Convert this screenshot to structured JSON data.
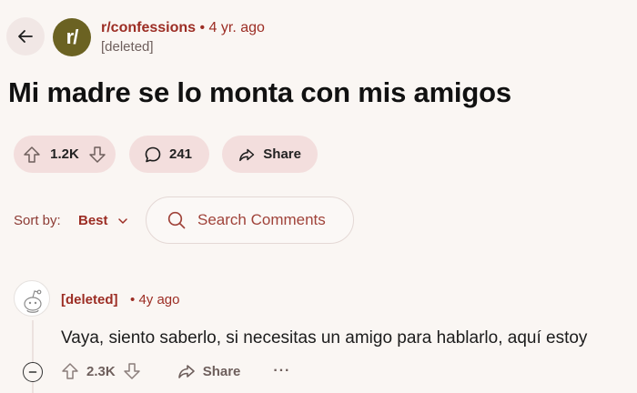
{
  "header": {
    "back_icon": "arrow-left-icon",
    "subreddit_avatar_text": "r/",
    "subreddit_avatar_color": "#6b6222",
    "subreddit_name": "r/confessions",
    "separator": "•",
    "post_age": "4 yr. ago",
    "author": "[deleted]"
  },
  "post": {
    "title": "Mi madre se lo monta con mis amigos",
    "upvote_count": "1.2K",
    "comment_count": "241",
    "share_label": "Share"
  },
  "sort": {
    "label": "Sort by:",
    "value": "Best"
  },
  "search": {
    "placeholder": "Search Comments"
  },
  "comment": {
    "author": "[deleted]",
    "separator": "•",
    "age": "4y ago",
    "body": "Vaya, siento saberlo, si necesitas un amigo para hablarlo, aquí estoy",
    "upvote_count": "2.3K",
    "share_label": "Share",
    "more_label": "···"
  },
  "colors": {
    "background": "#faf6f3",
    "pill": "#f3dedd",
    "accent": "#9c2d24"
  }
}
